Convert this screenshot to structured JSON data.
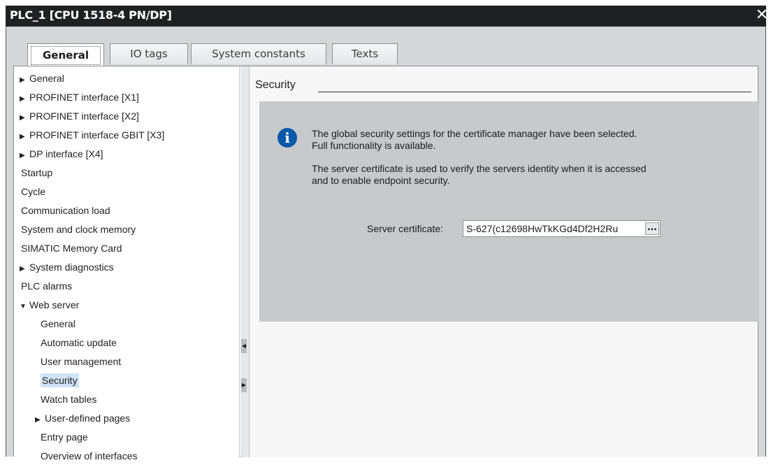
{
  "window": {
    "title": "PLC_1 [CPU 1518-4 PN/DP]",
    "close_glyph": "✕"
  },
  "tabs": [
    {
      "label": "General",
      "active": true
    },
    {
      "label": "IO tags",
      "active": false
    },
    {
      "label": "System constants",
      "active": false
    },
    {
      "label": "Texts",
      "active": false
    }
  ],
  "nav": [
    {
      "label": "General",
      "arrow": "right"
    },
    {
      "label": "PROFINET interface [X1]",
      "arrow": "right"
    },
    {
      "label": "PROFINET interface [X2]",
      "arrow": "right"
    },
    {
      "label": "PROFINET interface GBIT [X3]",
      "arrow": "right"
    },
    {
      "label": "DP interface [X4]",
      "arrow": "right"
    },
    {
      "label": "Startup"
    },
    {
      "label": "Cycle"
    },
    {
      "label": "Communication load"
    },
    {
      "label": "System and clock memory"
    },
    {
      "label": "SIMATIC Memory Card"
    },
    {
      "label": "System diagnostics",
      "arrow": "right"
    },
    {
      "label": "PLC alarms"
    },
    {
      "label": "Web server",
      "arrow": "down"
    },
    {
      "label": "General",
      "level": 1
    },
    {
      "label": "Automatic update",
      "level": 1
    },
    {
      "label": "User management",
      "level": 1
    },
    {
      "label": "Security",
      "level": 1,
      "selected": true
    },
    {
      "label": "Watch tables",
      "level": 1
    },
    {
      "label": "User-defined pages",
      "level": 1,
      "arrow": "right"
    },
    {
      "label": "Entry page",
      "level": 1
    },
    {
      "label": "Overview of interfaces",
      "level": 1
    }
  ],
  "section": {
    "title": "Security",
    "info_line1": "The global security settings for the certificate manager have been selected.",
    "info_line2": "Full functionality is available.",
    "info_line3": "The server certificate is used to verify the servers identity when it is accessed",
    "info_line4": "and to enable endpoint security.",
    "cert_label": "Server certificate:",
    "cert_value": "S-627(c12698HwTkKGd4Df2H2Ru",
    "browse_label": "..."
  },
  "colors": {
    "title_bar": "#1f2123",
    "info_icon": "#0a58a8",
    "selection": "#cfe3f5"
  }
}
